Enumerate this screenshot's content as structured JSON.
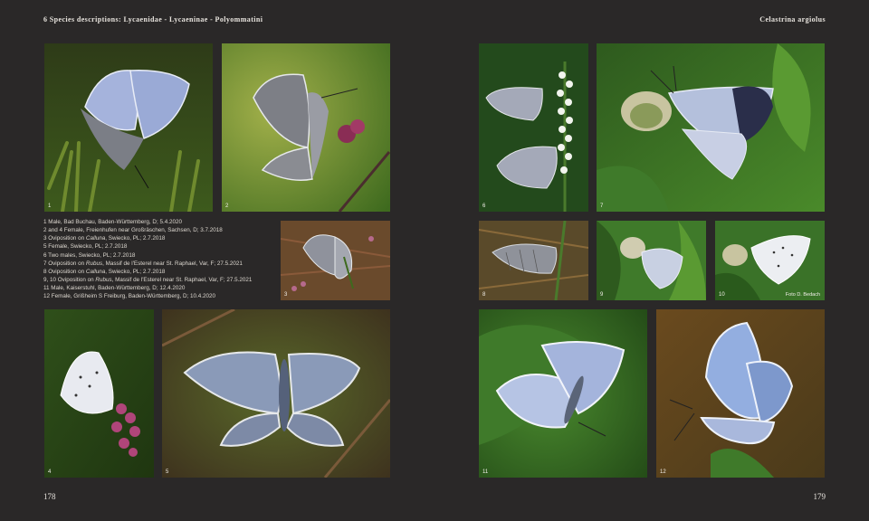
{
  "header": {
    "left": "6 Species descriptions: Lycaenidae - Lycaeninae - Polyommatini",
    "right": "Celastrina argiolus"
  },
  "folio": {
    "left": "178",
    "right": "179"
  },
  "captions": [
    {
      "pre": "1   Male, Bad Buchau, Baden-Württemberg, D; 5.4.2020",
      "ital": "",
      "post": ""
    },
    {
      "pre": "2 and 4 Female, Freienhufen near Großräschen, Sachsen, D; 3.7.2018",
      "ital": "",
      "post": ""
    },
    {
      "pre": "3   Oviposition on ",
      "ital": "Calluna",
      "post": ", Swiecko, PL; 2.7.2018"
    },
    {
      "pre": "5   Female, Swiecko, PL; 2.7.2018",
      "ital": "",
      "post": ""
    },
    {
      "pre": "6   Two males, Swiecko, PL; 2.7.2018",
      "ital": "",
      "post": ""
    },
    {
      "pre": "7   Oviposition on ",
      "ital": "Rubus",
      "post": ", Massif de l'Esterel near St. Raphael, Var, F; 27.5.2021"
    },
    {
      "pre": "8   Oviposition on ",
      "ital": "Calluna",
      "post": ", Swiecko, PL; 2.7.2018"
    },
    {
      "pre": "9, 10    Oviposition on ",
      "ital": "Rubus",
      "post": ", Massif de l'Esterel near St. Raphael, Var, F; 27.5.2021"
    },
    {
      "pre": "11 Male, Kaiserstuhl, Baden-Württemberg, D; 12.4.2020",
      "ital": "",
      "post": ""
    },
    {
      "pre": "12 Female, Grißheim S Freiburg, Baden-Württemberg, D; 10.4.2020",
      "ital": "",
      "post": ""
    }
  ],
  "photos": {
    "p1": "1",
    "p2": "2",
    "p3": "3",
    "p4": "4",
    "p5": "5",
    "p6": "6",
    "p7": "7",
    "p8": "8",
    "p9": "9",
    "p10": "10",
    "p11": "11",
    "p12": "12"
  },
  "credit": "Foto D. Bedach",
  "colors": {
    "background": "#2a2828",
    "wing_blue": "#a9b8dc",
    "leaf_green": "#3f7a2a",
    "heather_pink": "#b0457a"
  }
}
